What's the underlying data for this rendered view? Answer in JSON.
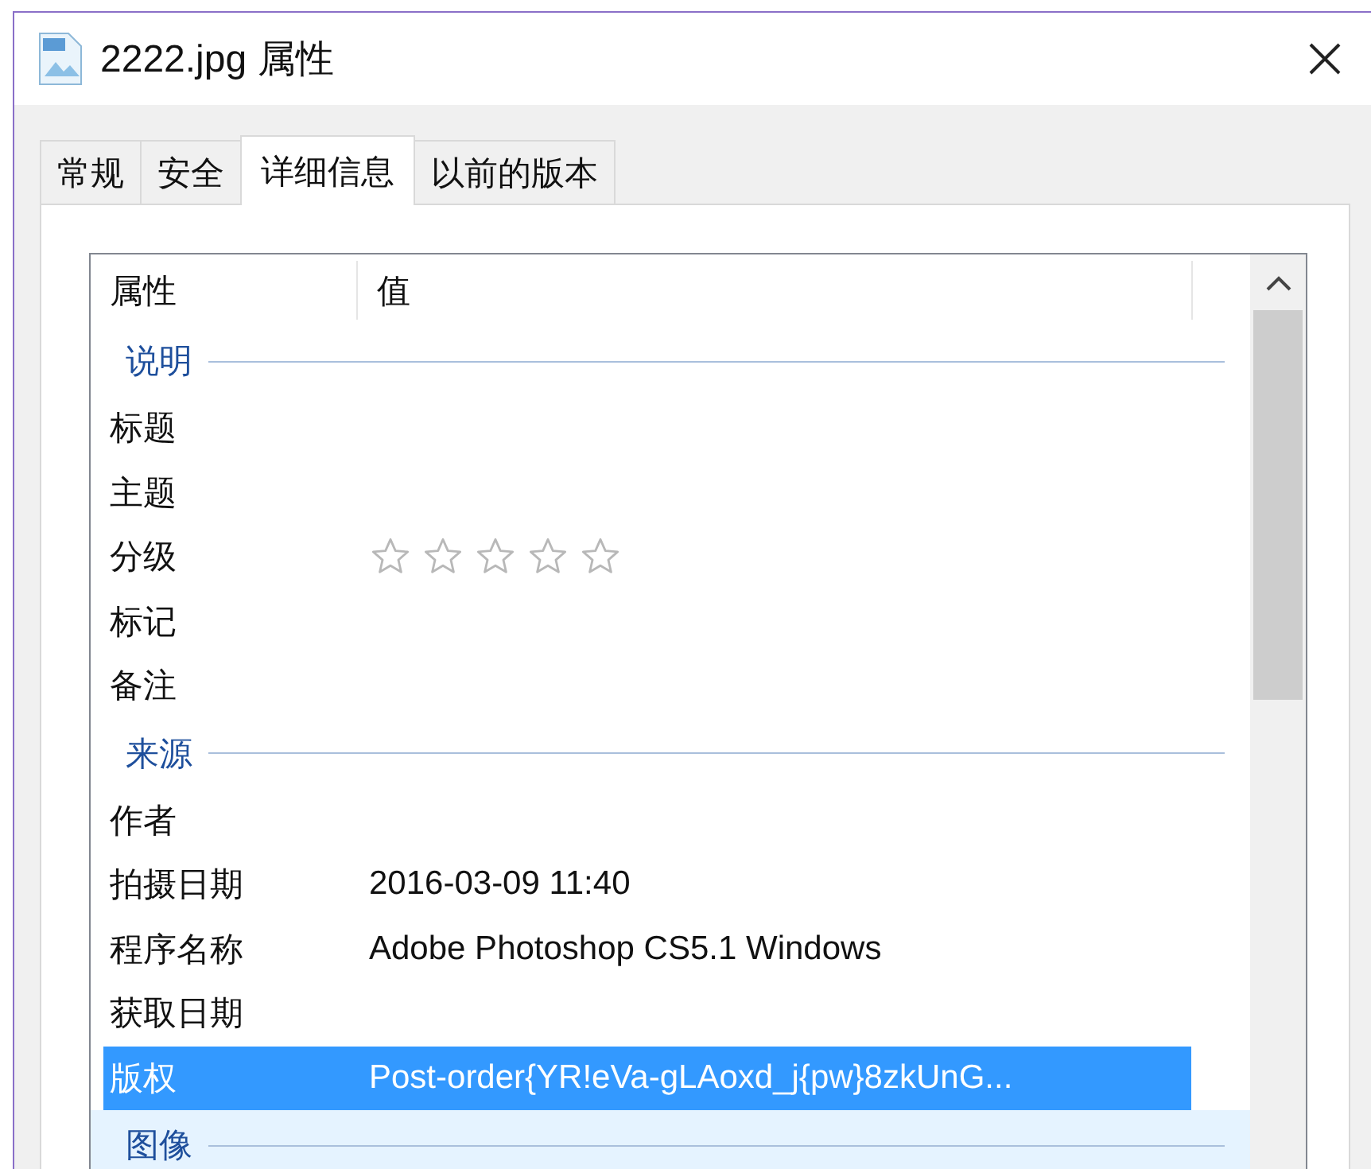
{
  "window": {
    "title": "2222.jpg 属性"
  },
  "tabs": [
    {
      "label": "常规",
      "selected": false
    },
    {
      "label": "安全",
      "selected": false
    },
    {
      "label": "详细信息",
      "selected": true
    },
    {
      "label": "以前的版本",
      "selected": false
    }
  ],
  "details": {
    "columns": [
      "属性",
      "值"
    ],
    "rows": [
      {
        "kind": "group",
        "label": "说明",
        "hovered": false
      },
      {
        "kind": "property",
        "name": "标题",
        "selected": false
      },
      {
        "kind": "property",
        "name": "主题",
        "selected": false
      },
      {
        "kind": "rating",
        "name": "分级",
        "stars": 0,
        "selected": false
      },
      {
        "kind": "property",
        "name": "标记",
        "selected": false
      },
      {
        "kind": "property",
        "name": "备注",
        "selected": false
      },
      {
        "kind": "group",
        "label": "来源",
        "hovered": false
      },
      {
        "kind": "property",
        "name": "作者",
        "selected": false
      },
      {
        "kind": "property",
        "name": "拍摄日期",
        "value": "2016-03-09 11:40",
        "selected": false
      },
      {
        "kind": "property",
        "name": "程序名称",
        "value": "Adobe Photoshop CS5.1 Windows",
        "selected": false
      },
      {
        "kind": "property",
        "name": "获取日期",
        "selected": false
      },
      {
        "kind": "property",
        "name": "版权",
        "value": "Post-order{YR!eVa-gLAoxd_j{pw}8zkUnG...",
        "selected": true
      },
      {
        "kind": "group",
        "label": "图像",
        "hovered": true
      }
    ]
  }
}
